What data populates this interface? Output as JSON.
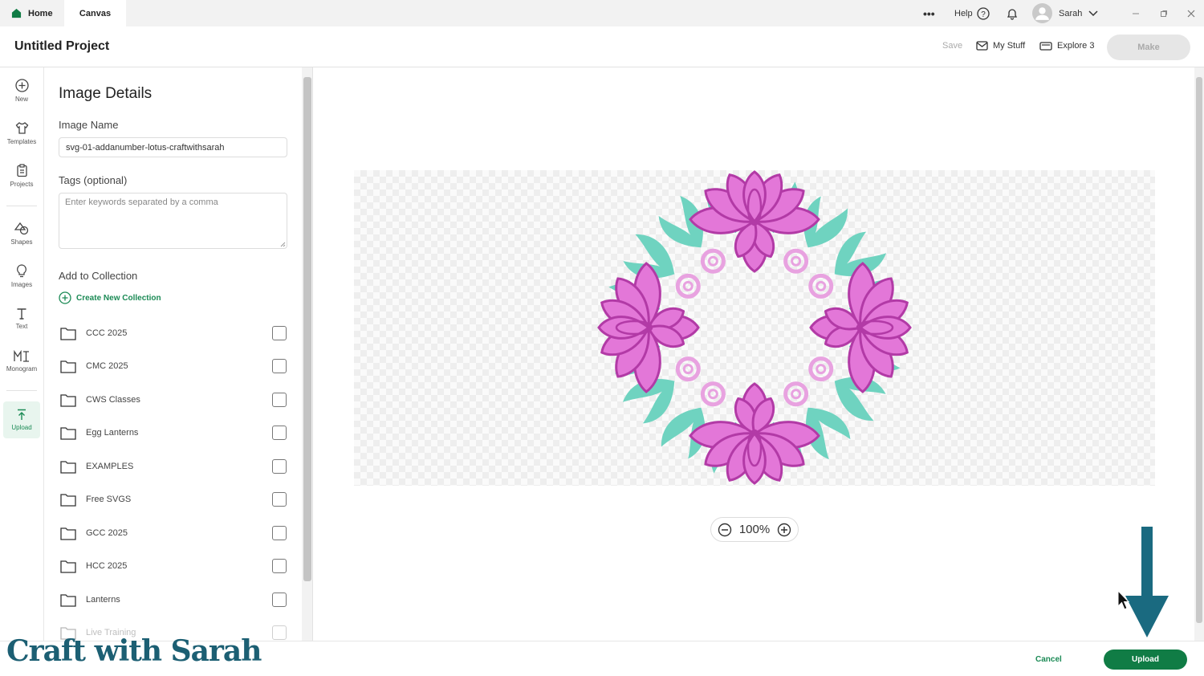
{
  "tabs": [
    {
      "label": "Home",
      "icon": "house-icon"
    },
    {
      "label": "Canvas"
    }
  ],
  "topbar": {
    "more": "•••",
    "help": "Help",
    "user": "Sarah"
  },
  "header": {
    "project_title": "Untitled Project",
    "save": "Save",
    "my_stuff": "My Stuff",
    "machine": "Explore 3",
    "make": "Make"
  },
  "leftbar": [
    {
      "label": "New",
      "icon": "plus-circle-icon"
    },
    {
      "label": "Templates",
      "icon": "tshirt-icon"
    },
    {
      "label": "Projects",
      "icon": "clipboard-icon"
    },
    {
      "label": "Shapes",
      "icon": "shapes-icon"
    },
    {
      "label": "Images",
      "icon": "lightbulb-icon"
    },
    {
      "label": "Text",
      "icon": "text-icon"
    },
    {
      "label": "Monogram",
      "icon": "monogram-icon"
    },
    {
      "label": "Upload",
      "icon": "upload-icon",
      "active": true
    }
  ],
  "panel": {
    "title": "Image Details",
    "name_label": "Image Name",
    "name_value": "svg-01-addanumber-lotus-craftwithsarah",
    "tags_label": "Tags (optional)",
    "tags_placeholder": "Enter keywords separated by a comma",
    "collection_label": "Add to Collection",
    "create_collection": "Create New Collection",
    "collections": [
      "CCC 2025",
      "CMC 2025",
      "CWS Classes",
      "Egg Lanterns",
      "EXAMPLES",
      "Free SVGS",
      "GCC 2025",
      "HCC 2025",
      "Lanterns",
      "Live Training"
    ]
  },
  "canvas": {
    "zoom": "100%",
    "colors": {
      "petal": "#e377d8",
      "petal_stroke": "#b23aa6",
      "leaf": "#6fd3c0",
      "swirl": "#e8a2e0"
    }
  },
  "footer": {
    "cancel": "Cancel",
    "upload": "Upload"
  },
  "watermark": "Craft with Sarah",
  "colors": {
    "accent": "#107c45",
    "arrow": "#1a6a80"
  }
}
